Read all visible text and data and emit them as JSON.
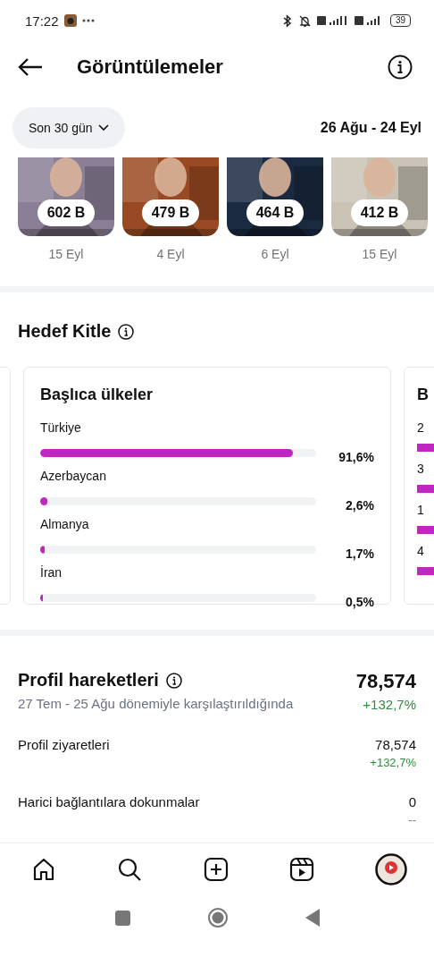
{
  "status_bar": {
    "time": "17:22",
    "battery": "39"
  },
  "header": {
    "title": "Görüntülemeler"
  },
  "filter": {
    "period": "Son 30 gün",
    "range": "26 Ağu - 24 Eyl"
  },
  "top_posts": [
    {
      "views": "602 B",
      "date": "15 Eyl"
    },
    {
      "views": "479 B",
      "date": "4 Eyl"
    },
    {
      "views": "464 B",
      "date": "6 Eyl"
    },
    {
      "views": "412 B",
      "date": "15 Eyl"
    }
  ],
  "audience": {
    "title": "Hedef Kitle",
    "card": {
      "title": "Başlıca ülkeler",
      "rows": [
        {
          "name": "Türkiye",
          "level": 0.916,
          "value": "91,6%"
        },
        {
          "name": "Azerbaycan",
          "level": 0.026,
          "value": "2,6%"
        },
        {
          "name": "Almanya",
          "level": 0.017,
          "value": "1,7%"
        },
        {
          "name": "İran",
          "level": 0.005,
          "value": "0,5%"
        }
      ]
    },
    "next_card": {
      "title": "B",
      "rows": [
        "2",
        "3",
        "1",
        "4"
      ]
    }
  },
  "profile": {
    "title": "Profil hareketleri",
    "total": "78,574",
    "compare": "27 Tem - 25 Ağu dönemiyle karşılaştırıldığında",
    "change": "+132,7%",
    "rows": [
      {
        "label": "Profil ziyaretleri",
        "value": "78,574",
        "change": "+132,7%",
        "positive": true
      },
      {
        "label": "Harici bağlantılara dokunmalar",
        "value": "0",
        "change": "--",
        "positive": false
      }
    ]
  },
  "nav": [
    {
      "kind": "home"
    },
    {
      "kind": "search"
    },
    {
      "kind": "create"
    },
    {
      "kind": "reels"
    },
    {
      "kind": "profile"
    }
  ]
}
